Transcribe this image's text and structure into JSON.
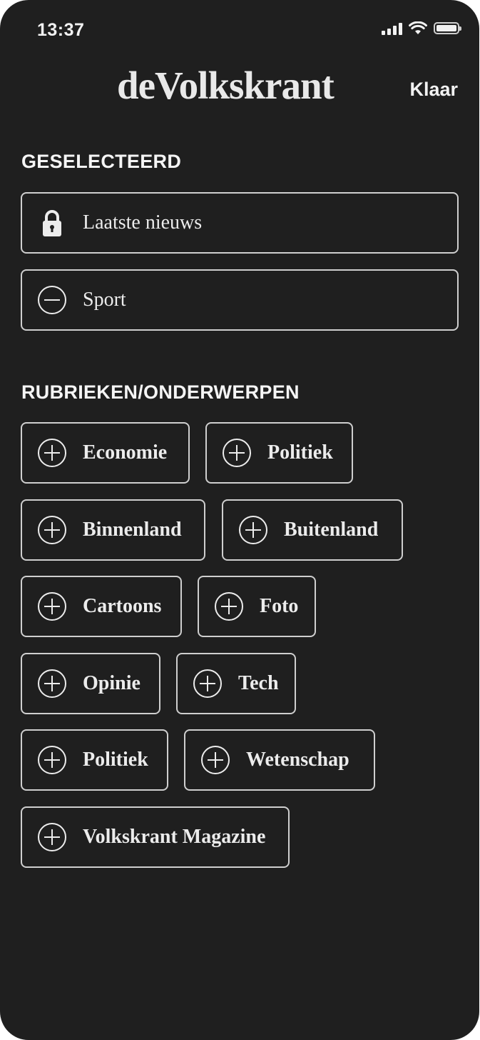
{
  "status_bar": {
    "time": "13:37"
  },
  "header": {
    "logo": "deVolkskrant",
    "done_label": "Klaar"
  },
  "selected": {
    "heading": "GESELECTEERD",
    "items": [
      {
        "label": "Laatste nieuws",
        "icon": "lock-icon"
      },
      {
        "label": "Sport",
        "icon": "minus-circle-icon"
      }
    ]
  },
  "topics": {
    "heading": "RUBRIEKEN/ONDERWERPEN",
    "items": [
      {
        "label": "Economie",
        "icon": "plus-circle-icon"
      },
      {
        "label": "Politiek",
        "icon": "plus-circle-icon"
      },
      {
        "label": "Binnenland",
        "icon": "plus-circle-icon"
      },
      {
        "label": "Buitenland",
        "icon": "plus-circle-icon"
      },
      {
        "label": "Cartoons",
        "icon": "plus-circle-icon"
      },
      {
        "label": "Foto",
        "icon": "plus-circle-icon"
      },
      {
        "label": "Opinie",
        "icon": "plus-circle-icon"
      },
      {
        "label": "Tech",
        "icon": "plus-circle-icon"
      },
      {
        "label": "Politiek",
        "icon": "plus-circle-icon"
      },
      {
        "label": "Wetenschap",
        "icon": "plus-circle-icon"
      },
      {
        "label": "Volkskrant Magazine",
        "icon": "plus-circle-icon"
      }
    ]
  }
}
